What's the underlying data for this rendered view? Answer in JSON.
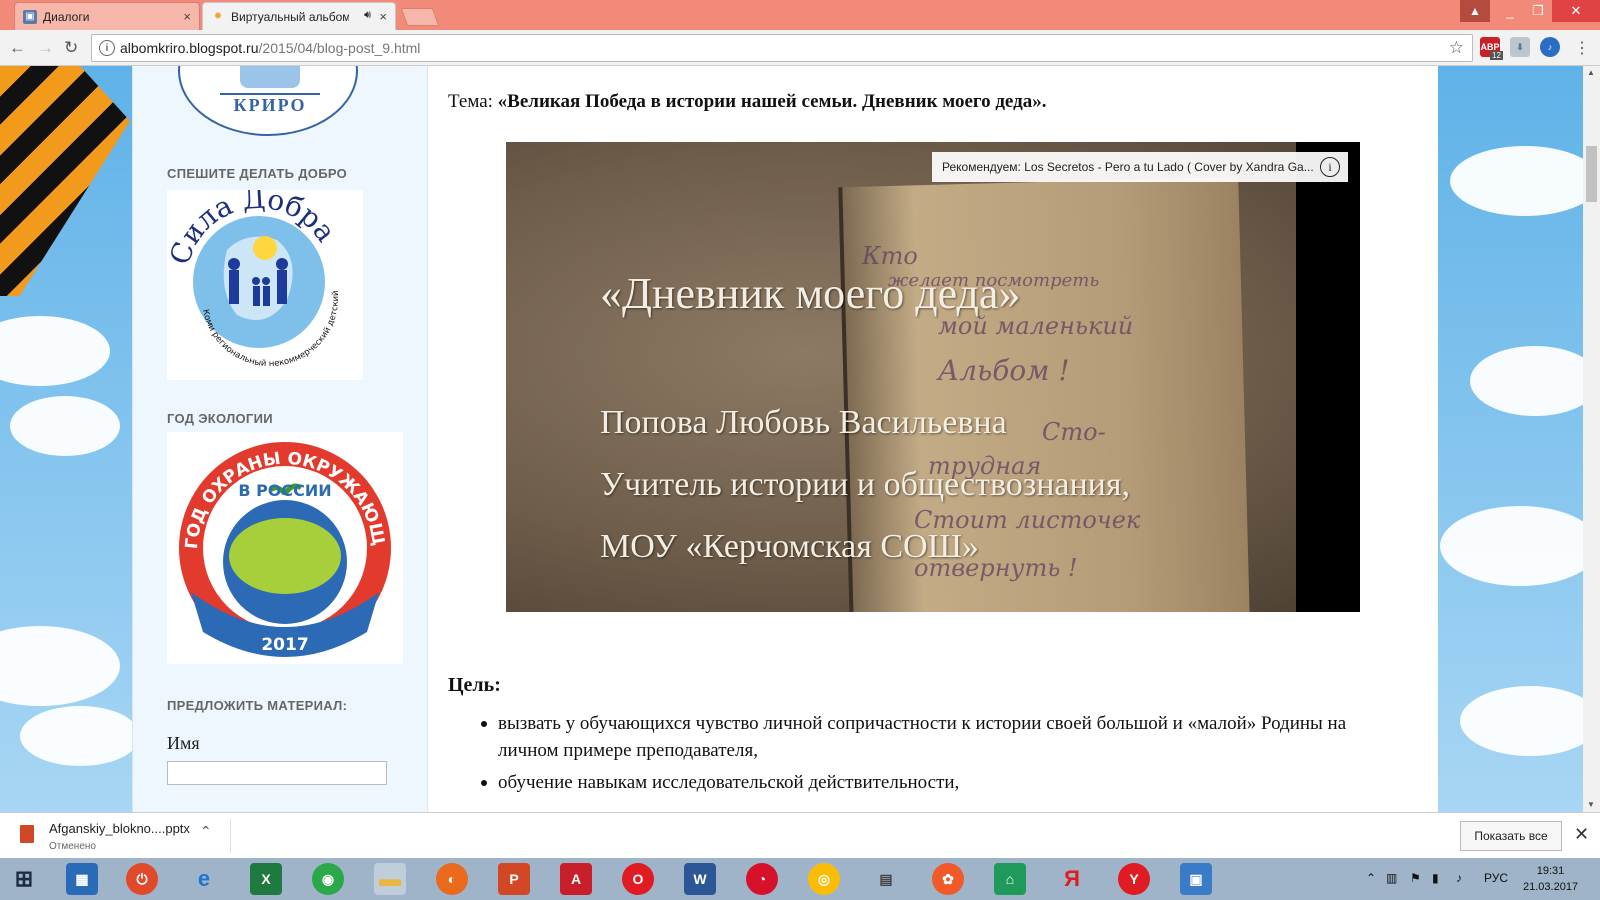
{
  "tabs": [
    {
      "label": "Диалоги",
      "close": "×"
    },
    {
      "label": "Виртуальный альбом",
      "close": "×"
    }
  ],
  "window_controls": [
    "_",
    "❐",
    "✕"
  ],
  "omnibox": {
    "host": "albomkriro.blogspot.ru",
    "path": "/2015/04/blog-post_9.html"
  },
  "extensions": {
    "abp_count": "12"
  },
  "sidebar": {
    "kriro_label": "КРИРО",
    "widget1_title": "СПЕШИТЕ ДЕЛАТЬ ДОБРО",
    "sila_title": "Сила Добра",
    "sila_sub": "Коми региональный некоммерческий детский благотворительный фонд",
    "widget2_title": "ГОД ЭКОЛОГИИ",
    "eco_top": "ГОД ОХРАНЫ ОКРУЖАЮЩЕЙ СРЕДЫ",
    "eco_mid": "В РОССИИ",
    "eco_year": "2017",
    "widget3_title": "ПРЕДЛОЖИТЬ МАТЕРИАЛ:",
    "name_label": "Имя",
    "name_value": ""
  },
  "post": {
    "theme_prefix": "Тема: ",
    "theme_title": "«Великая Победа в истории нашей семьи. Дневник моего деда».",
    "video": {
      "recommend": "Рекомендуем: Los Secretos - Pero a tu Lado ( Cover by Xandra Ga...",
      "info_icon": "i",
      "title": "«Дневник моего деда»",
      "author": "Попова Любовь Васильевна",
      "role": "Учитель истории и обществознания,",
      "school": "МОУ «Керчомская СОШ»",
      "handwriting": [
        "Кто",
        "желает посмотреть",
        "мой маленький",
        "Альбом !",
        "Сто-",
        "трудная",
        "Стоит листочек",
        "отвернуть !"
      ]
    },
    "goal_heading": "Цель:",
    "goals": [
      "вызвать у обучающихся чувство личной сопричастности к истории своей большой и «малой» Родины на личном примере преподавателя,",
      "обучение навыкам исследовательской действительности,"
    ]
  },
  "download": {
    "filename": "Afganskiy_blokno....pptx",
    "status": "Отменено",
    "show_all": "Показать все",
    "close": "✕"
  },
  "taskbar": {
    "lang": "РУС",
    "time": "19:31",
    "date": "21.03.2017"
  },
  "colors": {
    "tabbar": "#f28a7a",
    "sidebar": "#eef7fd",
    "sky": "#5fb2e8"
  }
}
